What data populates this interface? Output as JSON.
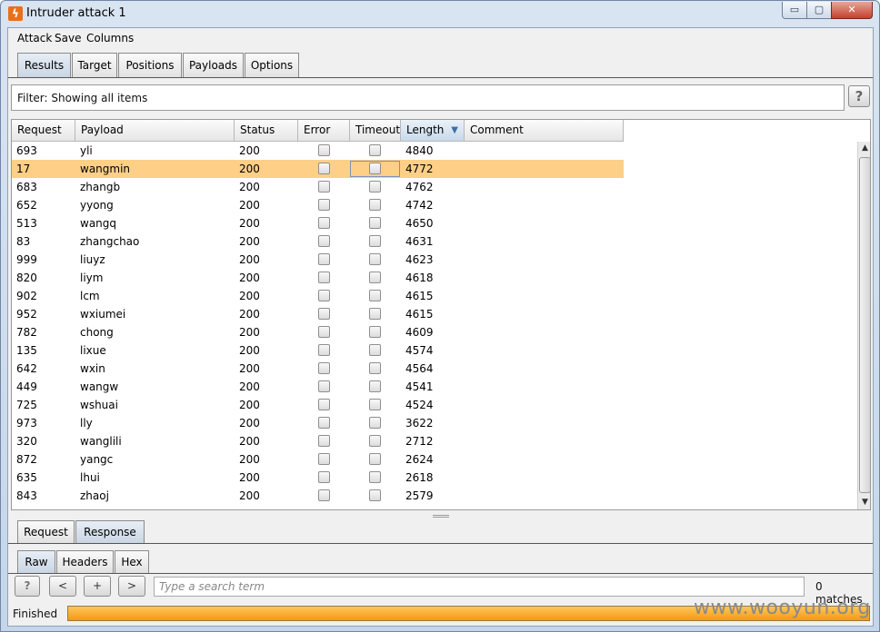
{
  "window": {
    "title": "Intruder attack 1",
    "minimize": "▭",
    "maximize": "▢",
    "close": "✕"
  },
  "menu": [
    "Attack",
    "Save",
    "Columns"
  ],
  "tabs": [
    "Results",
    "Target",
    "Positions",
    "Payloads",
    "Options"
  ],
  "active_tab": "Results",
  "filter": {
    "label": "Filter: Showing all items",
    "help": "?"
  },
  "table": {
    "columns": [
      "Request",
      "Payload",
      "Status",
      "Error",
      "Timeout",
      "Length",
      "Comment"
    ],
    "sorted_column": "Length",
    "sort_direction": "descending",
    "selected_row": 1,
    "rows": [
      {
        "request": "693",
        "payload": "yli",
        "status": "200",
        "error": false,
        "timeout": false,
        "length": "4840",
        "comment": ""
      },
      {
        "request": "17",
        "payload": "wangmin",
        "status": "200",
        "error": false,
        "timeout": false,
        "length": "4772",
        "comment": ""
      },
      {
        "request": "683",
        "payload": "zhangb",
        "status": "200",
        "error": false,
        "timeout": false,
        "length": "4762",
        "comment": ""
      },
      {
        "request": "652",
        "payload": "yyong",
        "status": "200",
        "error": false,
        "timeout": false,
        "length": "4742",
        "comment": ""
      },
      {
        "request": "513",
        "payload": "wangq",
        "status": "200",
        "error": false,
        "timeout": false,
        "length": "4650",
        "comment": ""
      },
      {
        "request": "83",
        "payload": "zhangchao",
        "status": "200",
        "error": false,
        "timeout": false,
        "length": "4631",
        "comment": ""
      },
      {
        "request": "999",
        "payload": "liuyz",
        "status": "200",
        "error": false,
        "timeout": false,
        "length": "4623",
        "comment": ""
      },
      {
        "request": "820",
        "payload": "liym",
        "status": "200",
        "error": false,
        "timeout": false,
        "length": "4618",
        "comment": ""
      },
      {
        "request": "902",
        "payload": "lcm",
        "status": "200",
        "error": false,
        "timeout": false,
        "length": "4615",
        "comment": ""
      },
      {
        "request": "952",
        "payload": "wxiumei",
        "status": "200",
        "error": false,
        "timeout": false,
        "length": "4615",
        "comment": ""
      },
      {
        "request": "782",
        "payload": "chong",
        "status": "200",
        "error": false,
        "timeout": false,
        "length": "4609",
        "comment": ""
      },
      {
        "request": "135",
        "payload": "lixue",
        "status": "200",
        "error": false,
        "timeout": false,
        "length": "4574",
        "comment": ""
      },
      {
        "request": "642",
        "payload": "wxin",
        "status": "200",
        "error": false,
        "timeout": false,
        "length": "4564",
        "comment": ""
      },
      {
        "request": "449",
        "payload": "wangw",
        "status": "200",
        "error": false,
        "timeout": false,
        "length": "4541",
        "comment": ""
      },
      {
        "request": "725",
        "payload": "wshuai",
        "status": "200",
        "error": false,
        "timeout": false,
        "length": "4524",
        "comment": ""
      },
      {
        "request": "973",
        "payload": "lly",
        "status": "200",
        "error": false,
        "timeout": false,
        "length": "3622",
        "comment": ""
      },
      {
        "request": "320",
        "payload": "wanglili",
        "status": "200",
        "error": false,
        "timeout": false,
        "length": "2712",
        "comment": ""
      },
      {
        "request": "872",
        "payload": "yangc",
        "status": "200",
        "error": false,
        "timeout": false,
        "length": "2624",
        "comment": ""
      },
      {
        "request": "635",
        "payload": "lhui",
        "status": "200",
        "error": false,
        "timeout": false,
        "length": "2618",
        "comment": ""
      },
      {
        "request": "843",
        "payload": "zhaoj",
        "status": "200",
        "error": false,
        "timeout": false,
        "length": "2579",
        "comment": ""
      }
    ]
  },
  "message_tabs": [
    "Request",
    "Response"
  ],
  "active_message_tab": "Response",
  "view_tabs": [
    "Raw",
    "Headers",
    "Hex"
  ],
  "active_view_tab": "Raw",
  "search": {
    "help": "?",
    "prev": "<",
    "add": "+",
    "next": ">",
    "placeholder": "Type a search term",
    "value": "",
    "matches": "0 matches"
  },
  "status": {
    "text": "Finished",
    "progress": 1.0
  },
  "watermark": "www.wooyun.org",
  "colors": {
    "selected_row": "#fdcf87",
    "progress": "#f29a14",
    "app_icon": "#e8701d"
  }
}
